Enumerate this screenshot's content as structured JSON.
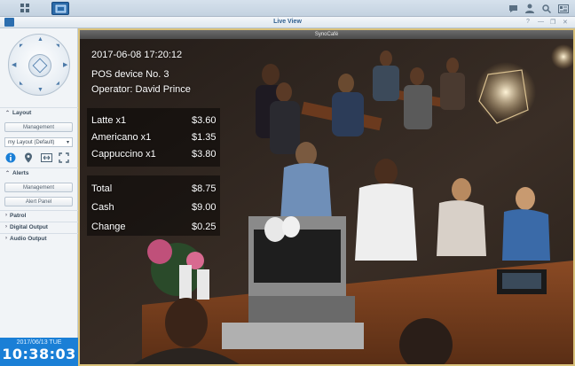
{
  "taskbar": {
    "icons": [
      "grid-icon",
      "surveillance-app-icon",
      "chat-icon",
      "user-icon",
      "search-icon",
      "widgets-icon"
    ]
  },
  "window": {
    "title": "Live View",
    "controls": [
      "?",
      "—",
      "❐",
      "✕"
    ]
  },
  "left_panel": {
    "layout": {
      "label": "Layout",
      "management_button": "Management",
      "layout_select": "my Layout (Default)"
    },
    "alerts": {
      "label": "Alerts",
      "management_button": "Management",
      "alert_panel_button": "Alert Panel"
    },
    "patrol": {
      "label": "Patrol"
    },
    "digital_output": {
      "label": "Digital Output"
    },
    "audio_output": {
      "label": "Audio Output"
    },
    "clock": {
      "date": "2017/06/13  TUE",
      "time": "10:38:03"
    }
  },
  "camera": {
    "name": "SynoCafé"
  },
  "pos_overlay": {
    "timestamp": "2017-06-08 17:20:12",
    "device": "POS device No. 3",
    "operator": "Operator:  David Prince",
    "items": [
      {
        "name": "Latte x1",
        "amount": "$3.60"
      },
      {
        "name": "Americano x1",
        "amount": "$1.35"
      },
      {
        "name": "Cappuccino x1",
        "amount": "$3.80"
      }
    ],
    "totals": [
      {
        "name": "Total",
        "amount": "$8.75"
      },
      {
        "name": "Cash",
        "amount": "$9.00"
      },
      {
        "name": "Change",
        "amount": "$0.25"
      }
    ]
  },
  "colors": {
    "accent": "#1a7fd6",
    "frame_highlight": "#d9c17a"
  }
}
